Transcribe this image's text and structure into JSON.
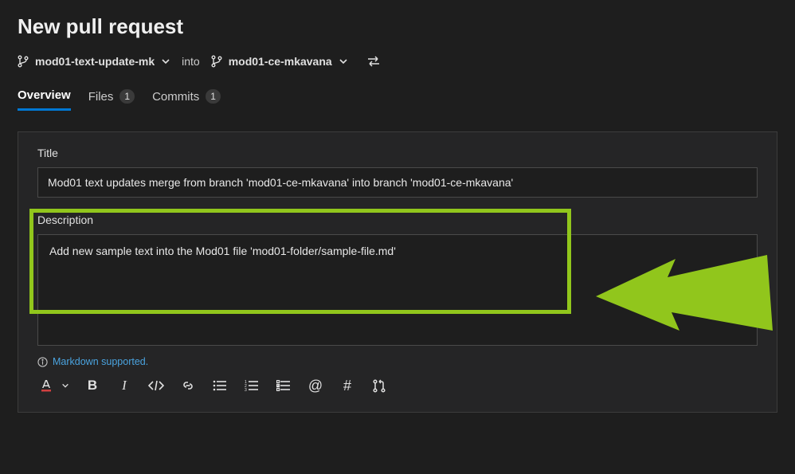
{
  "page": {
    "title": "New pull request"
  },
  "branches": {
    "source": "mod01-text-update-mk",
    "into_label": "into",
    "target": "mod01-ce-mkavana"
  },
  "tabs": {
    "overview": {
      "label": "Overview"
    },
    "files": {
      "label": "Files",
      "count": "1"
    },
    "commits": {
      "label": "Commits",
      "count": "1"
    }
  },
  "form": {
    "title_label": "Title",
    "title_value": "Mod01 text updates merge from branch 'mod01-ce-mkavana' into branch 'mod01-ce-mkavana'",
    "description_label": "Description",
    "description_value": "Add new sample text into the Mod01 file 'mod01-folder/sample-file.md'",
    "markdown_hint": "Markdown supported."
  },
  "colors": {
    "highlight": "#91c61c",
    "link": "#4aa3df",
    "tab_active": "#0078d4"
  }
}
